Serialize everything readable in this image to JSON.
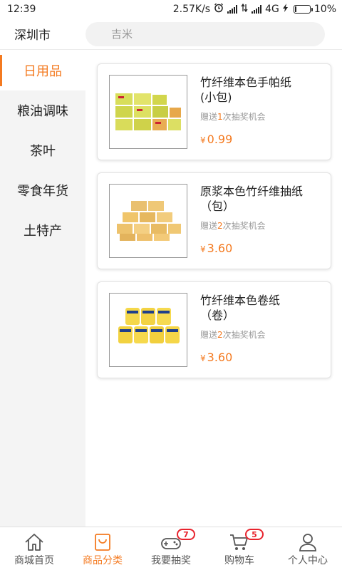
{
  "status_bar": {
    "time": "12:39",
    "network_speed": "2.57K/s",
    "network_type": "4G",
    "battery": "10%"
  },
  "header": {
    "city": "深圳市",
    "search_placeholder": "吉米"
  },
  "sidebar": {
    "items": [
      {
        "label": "日用品",
        "active": true
      },
      {
        "label": "粮油调味",
        "active": false
      },
      {
        "label": "茶叶",
        "active": false
      },
      {
        "label": "零食年货",
        "active": false
      },
      {
        "label": "土特产",
        "active": false
      }
    ]
  },
  "products": [
    {
      "name": "竹纤维本色手帕纸\n(小包)",
      "promo_prefix": "赠送",
      "promo_count": "1",
      "promo_suffix": "次抽奖机会",
      "currency": "¥",
      "price": "0.99"
    },
    {
      "name": "原浆本色竹纤维抽纸\n（包）",
      "promo_prefix": "赠送",
      "promo_count": "2",
      "promo_suffix": "次抽奖机会",
      "currency": "¥",
      "price": "3.60"
    },
    {
      "name": "竹纤维本色卷纸\n（卷）",
      "promo_prefix": "赠送",
      "promo_count": "2",
      "promo_suffix": "次抽奖机会",
      "currency": "¥",
      "price": "3.60"
    }
  ],
  "bottom_nav": {
    "items": [
      {
        "label": "商城首页",
        "icon": "home-icon"
      },
      {
        "label": "商品分类",
        "icon": "category-bag-icon"
      },
      {
        "label": "我要抽奖",
        "icon": "gamepad-icon",
        "badge": "7"
      },
      {
        "label": "购物车",
        "icon": "cart-icon",
        "badge": "5"
      },
      {
        "label": "个人中心",
        "icon": "user-icon"
      }
    ],
    "active_index": 1
  },
  "colors": {
    "accent": "#f47a20",
    "badge": "#e8232d",
    "sidebar_bg": "#f4f4f4"
  }
}
